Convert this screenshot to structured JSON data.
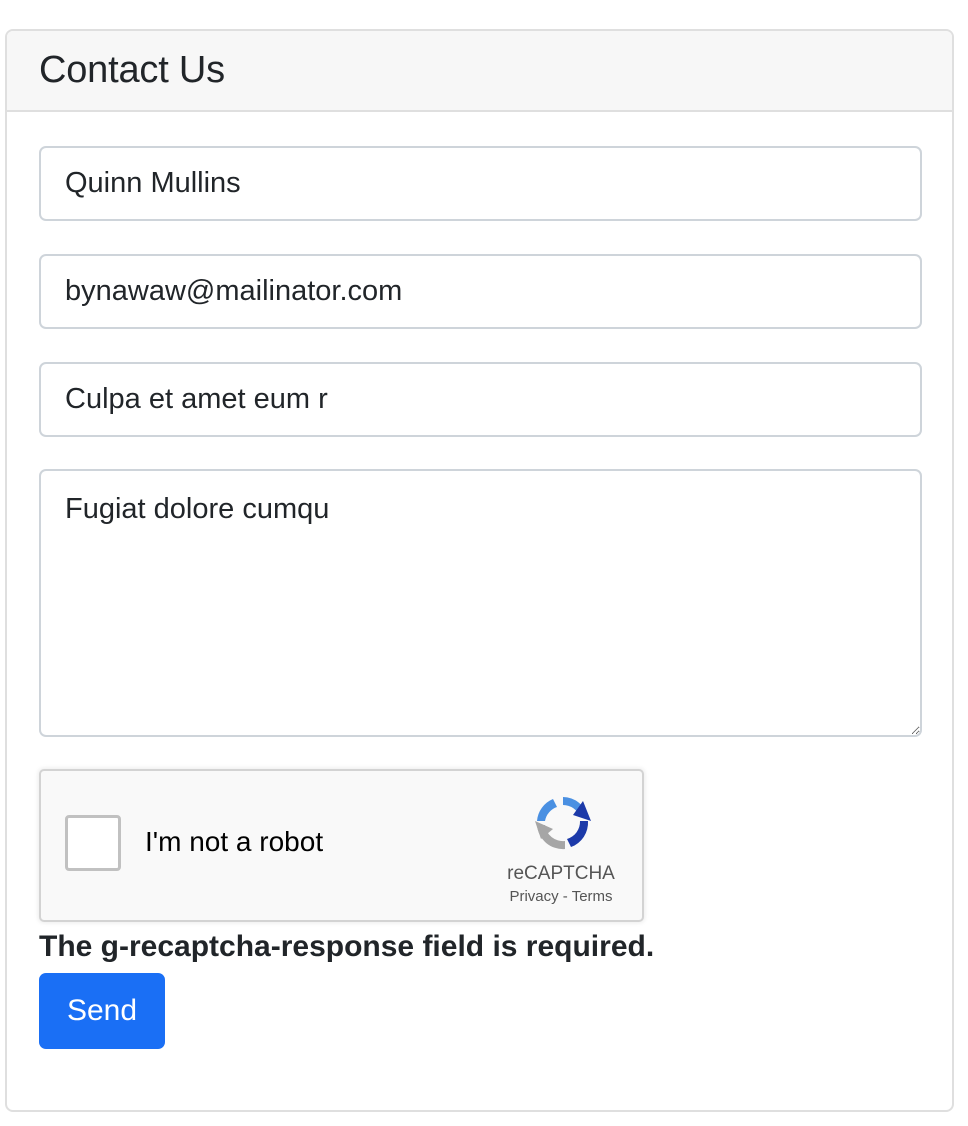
{
  "card": {
    "title": "Contact Us"
  },
  "form": {
    "name_value": "Quinn Mullins",
    "email_value": "bynawaw@mailinator.com",
    "subject_value": "Culpa et amet eum r",
    "message_value": "Fugiat dolore cumqu"
  },
  "recaptcha": {
    "label": "I'm not a robot",
    "brand": "reCAPTCHA",
    "privacy": "Privacy",
    "separator": " - ",
    "terms": "Terms",
    "checked": false,
    "logo_icon": "recaptcha-logo-icon"
  },
  "error": {
    "message": "The g-recaptcha-response field is required."
  },
  "actions": {
    "send_label": "Send"
  },
  "colors": {
    "primary_button": "#1a6ff5",
    "header_bg": "#f7f7f7",
    "border": "#ced4da"
  }
}
